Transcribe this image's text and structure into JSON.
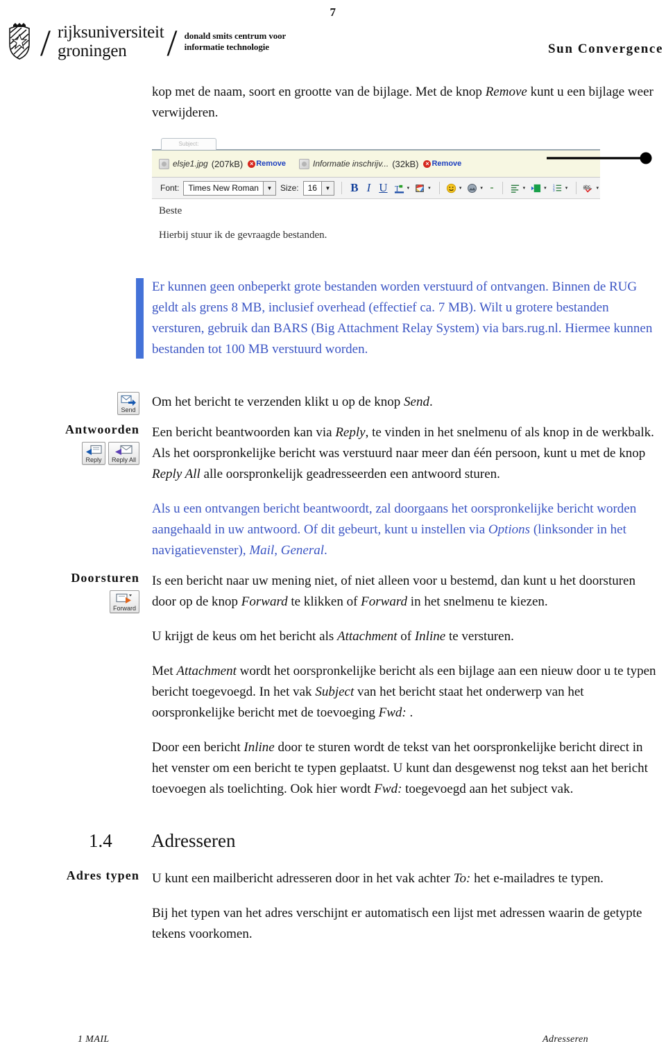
{
  "header": {
    "page_number": "7",
    "logo_line1": "rijksuniversiteit",
    "logo_line2": "groningen",
    "dsc_line1": "donald smits centrum voor",
    "dsc_line2": "informatie technologie",
    "slash": "/",
    "right_title": "Sun Convergence"
  },
  "intro": {
    "line_a": "kop met de naam, soort en grootte van de bijlage. Met de knop ",
    "emph": "Remove",
    "line_b": " kunt u een bijlage weer verwijderen."
  },
  "screenshot": {
    "tab_label": "Subject:",
    "attachments": [
      {
        "name": "elsje1.jpg",
        "size": "(207kB)",
        "remove": "Remove",
        "remove_mark": "×"
      },
      {
        "name": "Informatie inschrijv...",
        "size": "(32kB)",
        "remove": "Remove",
        "remove_mark": "×"
      }
    ],
    "toolbar": {
      "font_label": "Font:",
      "font_value": "Times New Roman",
      "size_label": "Size:",
      "size_value": "16",
      "dropdown_arrow": "▼",
      "bold": "B",
      "italic": "I",
      "underline": "U",
      "small_arrow": "▾",
      "spellcheck": "abc"
    },
    "body_line1": "Beste",
    "body_line2": "Hierbij stuur ik de gevraagde bestanden."
  },
  "note": {
    "text": "Er kunnen geen onbeperkt grote bestanden worden verstuurd of ontvangen. Binnen de RUG geldt als grens 8 MB, inclusief overhead (effectief ca. 7 MB). Wilt u grotere bestanden versturen, gebruik dan BARS (Big Attachment Relay System) via bars.rug.nl. Hiermee kunnen bestanden tot 100 MB verstuurd worden.",
    "accent_color": "#4472d8"
  },
  "send_row": {
    "button_caption": "Send",
    "text_a": "Om het bericht te verzenden klikt u op de knop ",
    "emph": "Send",
    "text_b": "."
  },
  "antwoorden": {
    "label": "Antwoorden",
    "reply_caption": "Reply",
    "reply_all_caption": "Reply All",
    "p1_a": "Een bericht beantwoorden kan via ",
    "p1_em1": "Reply",
    "p1_b": ", te vinden in het snelmenu of als knop in de werkbalk.  Als het oorspronkelijke bericht was verstuurd naar meer dan één persoon, kunt u met de knop ",
    "p1_em2": "Reply All",
    "p1_c": " alle oorspronkelijk geadresseerden een antwoord sturen.",
    "p2_a": "Als u een ontvangen bericht beantwoordt, zal doorgaans het oorspronkelijke bericht worden aangehaald in uw antwoord. Of dit gebeurt, kunt u instellen via ",
    "p2_em1": "Options",
    "p2_b": " (linksonder in het navigatievenster), ",
    "p2_em2": "Mail, General",
    "p2_c": ".",
    "blue_color": "#3b55c4"
  },
  "doorsturen": {
    "label": "Doorsturen",
    "forward_caption": "Forward",
    "p1_a": "Is een bericht naar uw mening niet, of niet alleen voor u bestemd, dan kunt u het doorsturen door op de knop ",
    "p1_em1": "Forward",
    "p1_b": " te klikken of ",
    "p1_em2": "Forward",
    "p1_c": " in het snelmenu te kiezen.",
    "p2_a": "U krijgt de keus om het bericht als ",
    "p2_em1": "Attachment",
    "p2_b": " of ",
    "p2_em2": "Inline",
    "p2_c": " te versturen.",
    "p3_a": "Met ",
    "p3_em1": "Attachment",
    "p3_b": " wordt het oorspronkelijke bericht als een bijlage aan een nieuw door u te typen bericht toegevoegd. In het vak ",
    "p3_em2": "Subject",
    "p3_c": " van het bericht staat het onderwerp van het oorspronkelijke bericht met de toevoeging ",
    "p3_em3": "Fwd:",
    "p3_d": " .",
    "p4_a": "Door een bericht ",
    "p4_em1": "Inline",
    "p4_b": " door te sturen wordt de tekst van het oorspronkelijke bericht direct in het venster om een bericht te typen geplaatst. U kunt dan desgewenst nog tekst aan het bericht toevoegen als toelichting. Ook hier wordt ",
    "p4_em2": "Fwd:",
    "p4_c": " toegevoegd aan het subject vak."
  },
  "section": {
    "number": "1.4",
    "title": "Adresseren"
  },
  "adres_typen": {
    "label": "Adres typen",
    "p1_a": "U kunt een mailbericht adresseren door in het vak achter ",
    "p1_em1": "To:",
    "p1_b": " het e-mailadres te typen.",
    "p2": "Bij het typen van het adres verschijnt er automatisch een lijst met adressen waarin de getypte tekens voorkomen."
  },
  "footer": {
    "left": "1 MAIL",
    "right": "Adresseren"
  }
}
